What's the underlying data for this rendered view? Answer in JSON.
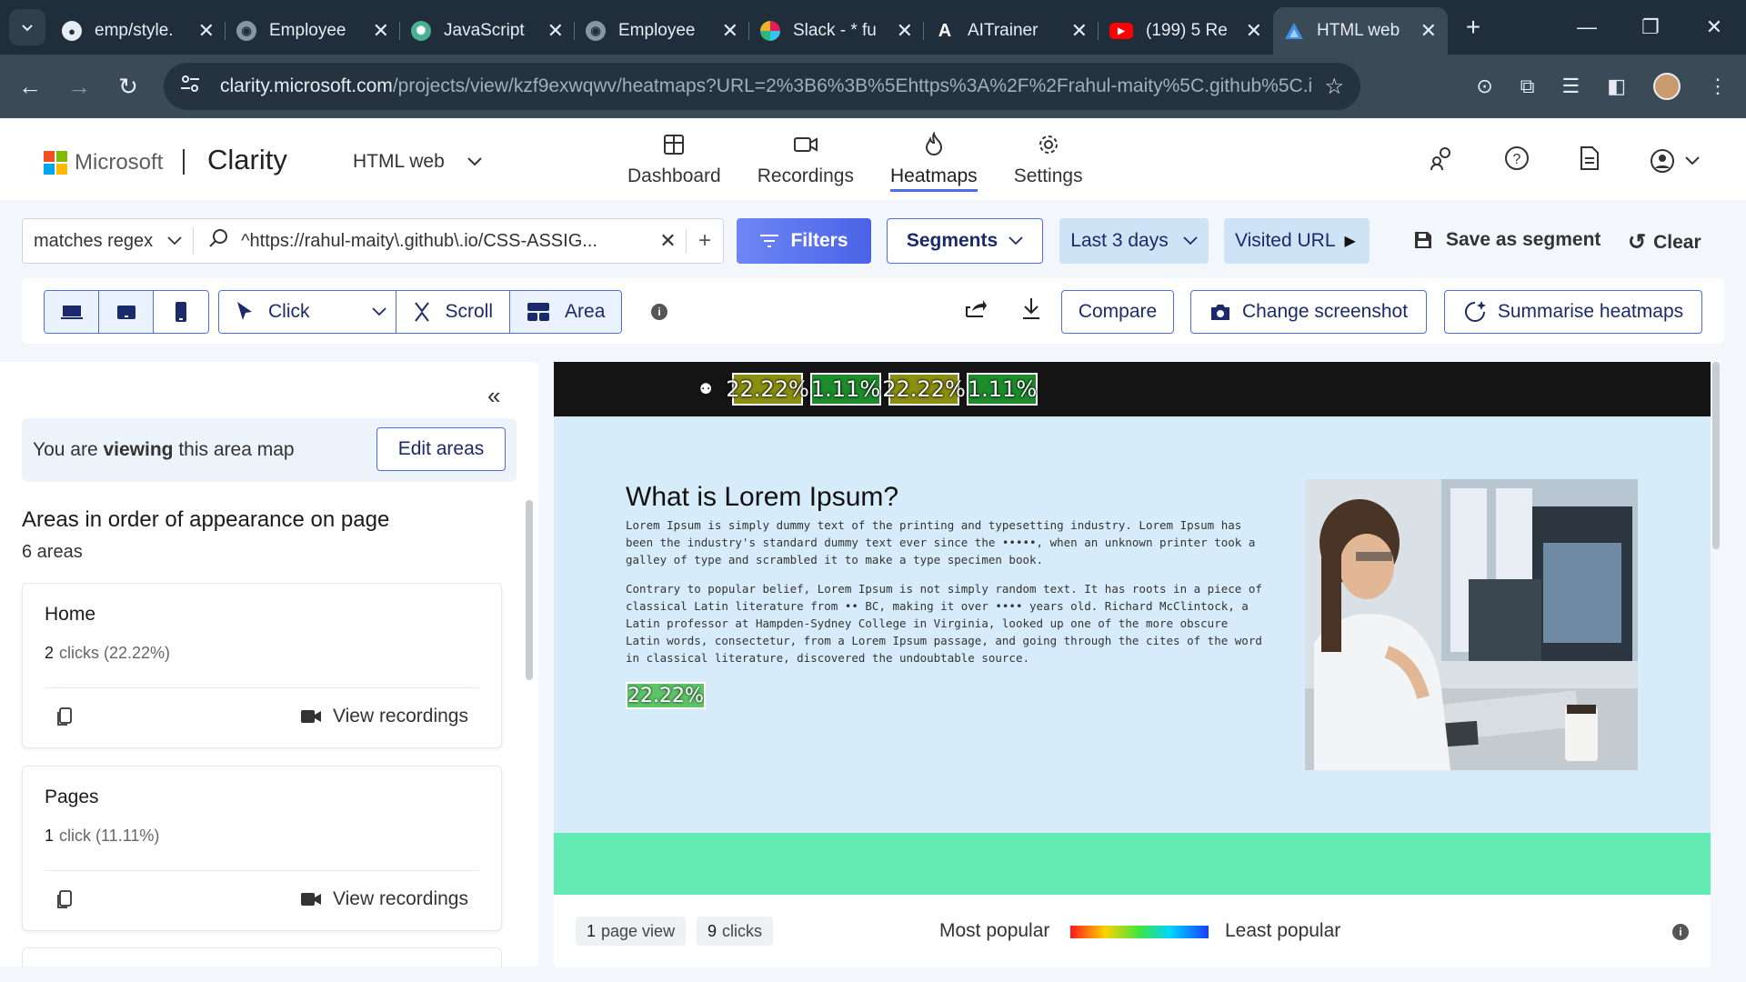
{
  "browser": {
    "tabs": [
      {
        "title": "emp/style.",
        "icon": "github-icon"
      },
      {
        "title": "Employee",
        "icon": "globe-icon"
      },
      {
        "title": "JavaScript",
        "icon": "chatgpt-icon"
      },
      {
        "title": "Employee",
        "icon": "globe-icon"
      },
      {
        "title": "Slack - * fu",
        "icon": "slack-icon"
      },
      {
        "title": "AITrainer",
        "icon": "aitrainer-icon"
      },
      {
        "title": "(199) 5 Re",
        "icon": "youtube-icon"
      },
      {
        "title": "HTML web",
        "icon": "clarity-icon"
      }
    ],
    "active_tab": 7,
    "url_host": "clarity.microsoft.com",
    "url_path": "/projects/view/kzf9exwqwv/heatmaps?URL=2%3B6%3B%5Ehttps%3A%2F%2Frahul-maity%5C.github%5C.i..."
  },
  "header": {
    "microsoft": "Microsoft",
    "brand": "Clarity",
    "project": "HTML web",
    "nav": [
      {
        "label": "Dashboard",
        "icon": "dashboard-icon"
      },
      {
        "label": "Recordings",
        "icon": "video-icon"
      },
      {
        "label": "Heatmaps",
        "icon": "flame-icon"
      },
      {
        "label": "Settings",
        "icon": "gear-icon"
      }
    ],
    "active_nav": "Heatmaps"
  },
  "filterbar": {
    "operator": "matches regex",
    "query": "^https://rahul-maity\\.github\\.io/CSS-ASSIG...",
    "filters_label": "Filters",
    "segments_label": "Segments",
    "date_label": "Last 3 days",
    "visited_label": "Visited URL",
    "save_segment_label": "Save as segment",
    "clear_label": "Clear"
  },
  "toolbar": {
    "modes": [
      {
        "label": "Click",
        "icon": "cursor-icon"
      },
      {
        "label": "Scroll",
        "icon": "scroll-icon"
      },
      {
        "label": "Area",
        "icon": "area-icon"
      }
    ],
    "compare_label": "Compare",
    "change_screenshot_label": "Change screenshot",
    "summarise_label": "Summarise heatmaps"
  },
  "leftpanel": {
    "viewing_prefix": "You are",
    "viewing_bold": "viewing",
    "viewing_suffix": "this area map",
    "edit_areas_label": "Edit areas",
    "title": "Areas in order of appearance on page",
    "count": "6 areas",
    "areas": [
      {
        "name": "Home",
        "clicks_num": "2",
        "clicks_text": "clicks (22.22%)",
        "view_label": "View recordings"
      },
      {
        "name": "Pages",
        "clicks_num": "1",
        "clicks_text": "click (11.11%)",
        "view_label": "View recordings"
      }
    ]
  },
  "canvas": {
    "nav_badges": [
      "22.22%",
      "1.11%",
      "22.22%",
      "1.11%"
    ],
    "heading": "What is Lorem Ipsum?",
    "para1": "Lorem Ipsum is simply dummy text of the printing and typesetting industry. Lorem Ipsum has been the industry's standard dummy text ever since the •••••, when an unknown printer took a galley of type and scrambled it to make a type specimen book.",
    "para2": "Contrary to popular belief, Lorem Ipsum is not simply random text. It has roots in a piece of classical Latin literature from •• BC, making it over •••• years old. Richard McClintock, a Latin professor at Hampden-Sydney College in Virginia, looked up one of the more obscure Latin words, consectetur, from a Lorem Ipsum passage, and going through the cites of the word in classical literature, discovered the undoubtable source.",
    "content_badge": "22.22%"
  },
  "legend": {
    "page_views_num": "1",
    "page_views_text": "page view",
    "clicks_num": "9",
    "clicks_text": "clicks",
    "most": "Most popular",
    "least": "Least popular"
  },
  "colors": {
    "accent": "#4f6bed",
    "chrome_dark": "#1f2e3a",
    "chip_bg": "#cfe3f7",
    "canvas_bg": "#d7ecfb",
    "green_band": "#64eab3"
  }
}
